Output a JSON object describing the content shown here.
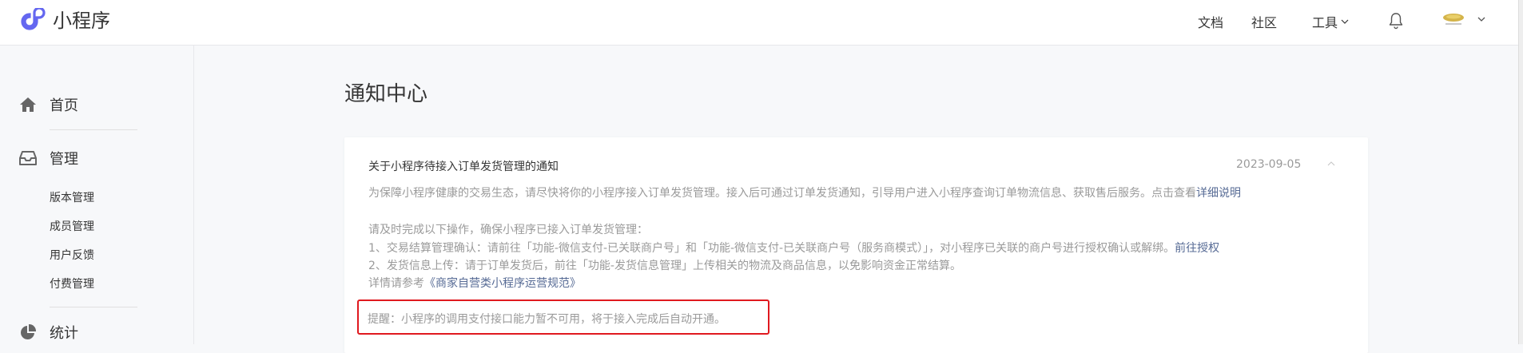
{
  "header": {
    "brand": "小程序",
    "nav": {
      "docs": "文档",
      "community": "社区",
      "tools": "工具"
    }
  },
  "sidebar": {
    "home": "首页",
    "manage": "管理",
    "manage_items": [
      "版本管理",
      "成员管理",
      "用户反馈",
      "付费管理"
    ],
    "stats": "统计"
  },
  "main": {
    "title": "通知中心",
    "notice": {
      "title": "关于小程序待接入订单发货管理的通知",
      "date": "2023-09-05",
      "intro": "为保障小程序健康的交易生态，请尽快将你的小程序接入订单发货管理。接入后可通过订单发货通知，引导用户进入小程序查询订单物流信息、获取售后服务。点击查看",
      "intro_link": "详细说明",
      "steps_heading": "请及时完成以下操作，确保小程序已接入订单发货管理：",
      "step1": "1、交易结算管理确认：请前往「功能-微信支付-已关联商户号」和「功能-微信支付-已关联商户号（服务商模式）」，对小程序已关联的商户号进行授权确认或解绑。",
      "step1_link": "前往授权",
      "step2": "2、发货信息上传：请于订单发货后，前往「功能-发货信息管理」上传相关的物流及商品信息，以免影响资金正常结算。",
      "details_prefix": "详情请参考",
      "details_link": "《商家自营类小程序运营规范》",
      "reminder": "提醒：小程序的调用支付接口能力暂不可用，将于接入完成后自动开通。"
    }
  },
  "icons": {
    "logo": "miniprogram-logo-icon",
    "home": "home-icon",
    "manage": "inbox-icon",
    "stats": "pie-chart-icon",
    "bell": "bell-icon",
    "chevron": "chevron-down-icon"
  },
  "colors": {
    "brand_logo": "#6467f0",
    "link": "#576b95",
    "highlight_border": "#e0191f",
    "muted_text": "#9a9a9a"
  }
}
